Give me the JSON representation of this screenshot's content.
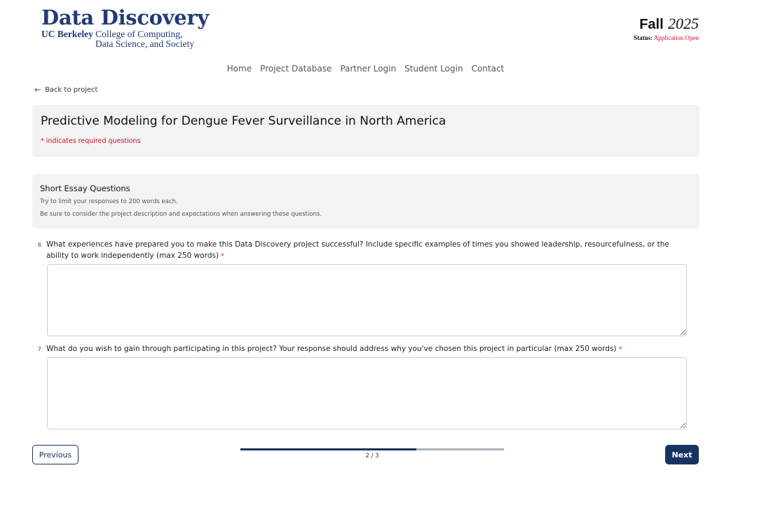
{
  "header": {
    "logo_title": "Data Discovery",
    "logo_org_bold": "UC Berkeley",
    "logo_org_line1": "College of Computing,",
    "logo_org_line2": "Data Science, and Society",
    "term_season": "Fall",
    "term_year": "2025",
    "status_label": "Status:",
    "status_value": "Application Open"
  },
  "nav": {
    "items": [
      "Home",
      "Project Database",
      "Partner Login",
      "Student Login",
      "Contact"
    ]
  },
  "back_link": {
    "label": "Back to project"
  },
  "project": {
    "title": "Predictive Modeling for Dengue Fever Surveillance in North America",
    "required_note": "* indicates required questions"
  },
  "section": {
    "title": "Short Essay Questions",
    "desc1": "Try to limit your responses to 200 words each.",
    "desc2": "Be sure to consider the project description and expectations when answering these questions."
  },
  "questions": [
    {
      "number": "6.",
      "text": "What experiences have prepared you to make this Data Discovery project successful? Include specific examples of times you showed leadership, resourcefulness, or the ability to work independently (max 250 words)",
      "required_mark": "*",
      "value": ""
    },
    {
      "number": "7.",
      "text": "What do you wish to gain through participating in this project? Your response should address why you've chosen this project in particular (max 250 words)",
      "required_mark": "*",
      "value": ""
    }
  ],
  "footer": {
    "previous_label": "Previous",
    "next_label": "Next",
    "progress_label": "2 / 3",
    "progress_fraction": 0.667
  },
  "colors": {
    "brand_navy": "#173461",
    "required_red": "#c8102e"
  }
}
